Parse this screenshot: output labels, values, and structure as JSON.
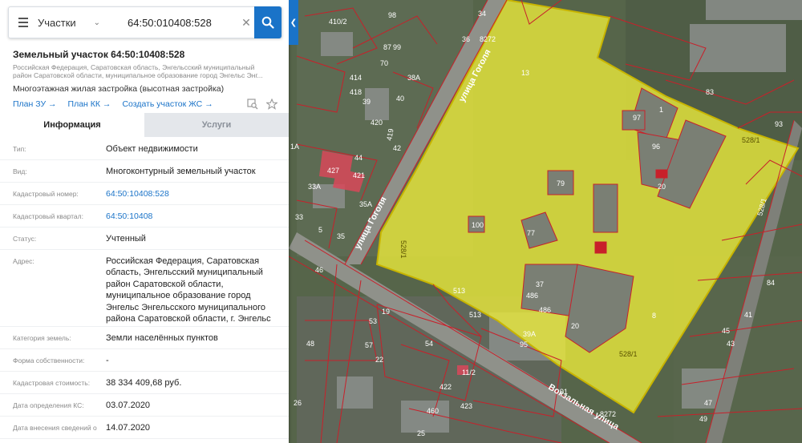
{
  "search": {
    "layer": "Участки",
    "query": "64:50:010408:528"
  },
  "object": {
    "title": "Земельный участок 64:50:10408:528",
    "address_short": "Российская Федерация, Саратовская область, Энгельсский муниципальный район Саратовской области, муниципальное образование город Энгельс Энг...",
    "permitted_use": "Многоэтажная жилая застройка (высотная застройка)",
    "links": [
      "План ЗУ",
      "План КК",
      "Создать участок ЖС"
    ]
  },
  "tabs": [
    {
      "label": "Информация",
      "active": true
    },
    {
      "label": "Услуги",
      "active": false
    }
  ],
  "info_rows": [
    {
      "key": "Тип:",
      "value": "Объект недвижимости"
    },
    {
      "key": "Вид:",
      "value": "Многоконтурный земельный участок"
    },
    {
      "key": "Кадастровый номер:",
      "value": "64:50:10408:528",
      "link": true
    },
    {
      "key": "Кадастровый квартал:",
      "value": "64:50:10408",
      "link": true
    },
    {
      "key": "Статус:",
      "value": "Учтенный"
    },
    {
      "key": "Адрес:",
      "value": "Российская Федерация, Саратовская область, Энгельсский муниципальный район Саратовской области, муниципальное образование город Энгельс Энгельсского муниципального района Саратовской области, г. Энгельс"
    },
    {
      "key": "Категория земель:",
      "value": "Земли населённых пунктов"
    },
    {
      "key": "Форма собственности:",
      "value": "-"
    },
    {
      "key": "Кадастровая стоимость:",
      "value": "38 334 409,68 руб."
    },
    {
      "key": "Дата определения КС:",
      "value": "03.07.2020"
    },
    {
      "key": "Дата внесения сведений о",
      "value": "14.07.2020"
    }
  ],
  "map": {
    "streets": [
      "улица Гоголя",
      "улица Гоголя",
      "Вокзальная улица"
    ],
    "parcel_labels": [
      "528/1",
      "528/1",
      "528/1",
      "528/1",
      "8272",
      "8272"
    ],
    "lot_numbers": [
      "13",
      "1",
      "97",
      "96",
      "20",
      "79",
      "100",
      "77",
      "37",
      "486",
      "486",
      "20",
      "8",
      "39А",
      "95",
      "513",
      "513",
      "38А",
      "40",
      "42",
      "44",
      "33А",
      "35А",
      "35",
      "33",
      "5",
      "1А",
      "46",
      "48",
      "26",
      "11/2",
      "54",
      "19",
      "22",
      "53",
      "57",
      "91",
      "93",
      "83",
      "84",
      "45",
      "41",
      "47",
      "49",
      "43",
      "36",
      "34",
      "410/2",
      "414",
      "418",
      "420",
      "419",
      "421",
      "99",
      "98",
      "70",
      "87",
      "39",
      "25",
      "460",
      "427",
      "422",
      "423"
    ],
    "colors": {
      "parcel_fill": "#e6e63c",
      "parcel_border": "#c8b400",
      "boundary": "#c8202a",
      "road": "#9a9a94",
      "accent": "#1a73c8"
    }
  }
}
